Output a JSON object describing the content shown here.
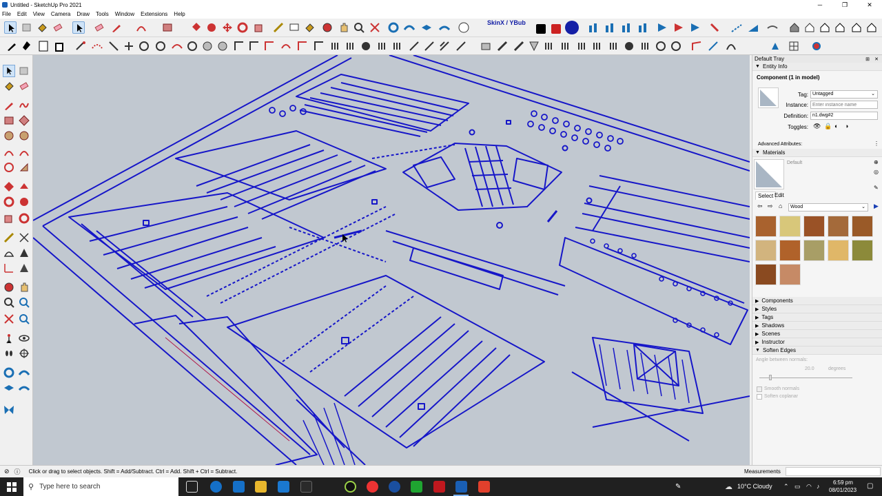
{
  "window": {
    "title": "Untitled - SketchUp Pro 2021",
    "min": "─",
    "max": "❐",
    "close": "✕"
  },
  "menu": [
    "File",
    "Edit",
    "View",
    "Camera",
    "Draw",
    "Tools",
    "Window",
    "Extensions",
    "Help"
  ],
  "toolbar": {
    "skinx_label": "SkinX / YBub"
  },
  "tray": {
    "title": "Default Tray",
    "entity_info": {
      "header": "Entity Info",
      "subtitle": "Component (1 in model)",
      "tag_label": "Tag:",
      "tag_value": "Untagged",
      "instance_label": "Instance:",
      "instance_placeholder": "Enter instance name",
      "definition_label": "Definition:",
      "definition_value": "n1.dwg#2",
      "toggles_label": "Toggles:",
      "advanced": "Advanced Attributes:"
    },
    "materials": {
      "header": "Materials",
      "current": "Default",
      "tab_select": "Select",
      "tab_edit": "Edit",
      "library": "Wood",
      "swatches": [
        "#a9622e",
        "#d8c77a",
        "#9a5226",
        "#a46a3a",
        "#9a5a28",
        "#d2b47e",
        "#b0622a",
        "#a89e66",
        "#e0b768",
        "#8c8a3a",
        "#8a4a20",
        "#c68a66"
      ]
    },
    "sections": [
      "Components",
      "Styles",
      "Tags",
      "Shadows",
      "Scenes",
      "Instructor",
      "Soften Edges"
    ],
    "soften": {
      "angle_label": "Angle between normals:",
      "angle_value": "20.0",
      "angle_unit": "degrees",
      "smooth": "Smooth normals",
      "coplanar": "Soften coplanar"
    }
  },
  "status": {
    "hint": "Click or drag to select objects. Shift = Add/Subtract. Ctrl = Add. Shift + Ctrl = Subtract.",
    "measurements_label": "Measurements"
  },
  "taskbar": {
    "search_placeholder": "Type here to search",
    "weather": "10°C  Cloudy",
    "time": "6:59 pm",
    "date": "08/01/2023"
  }
}
